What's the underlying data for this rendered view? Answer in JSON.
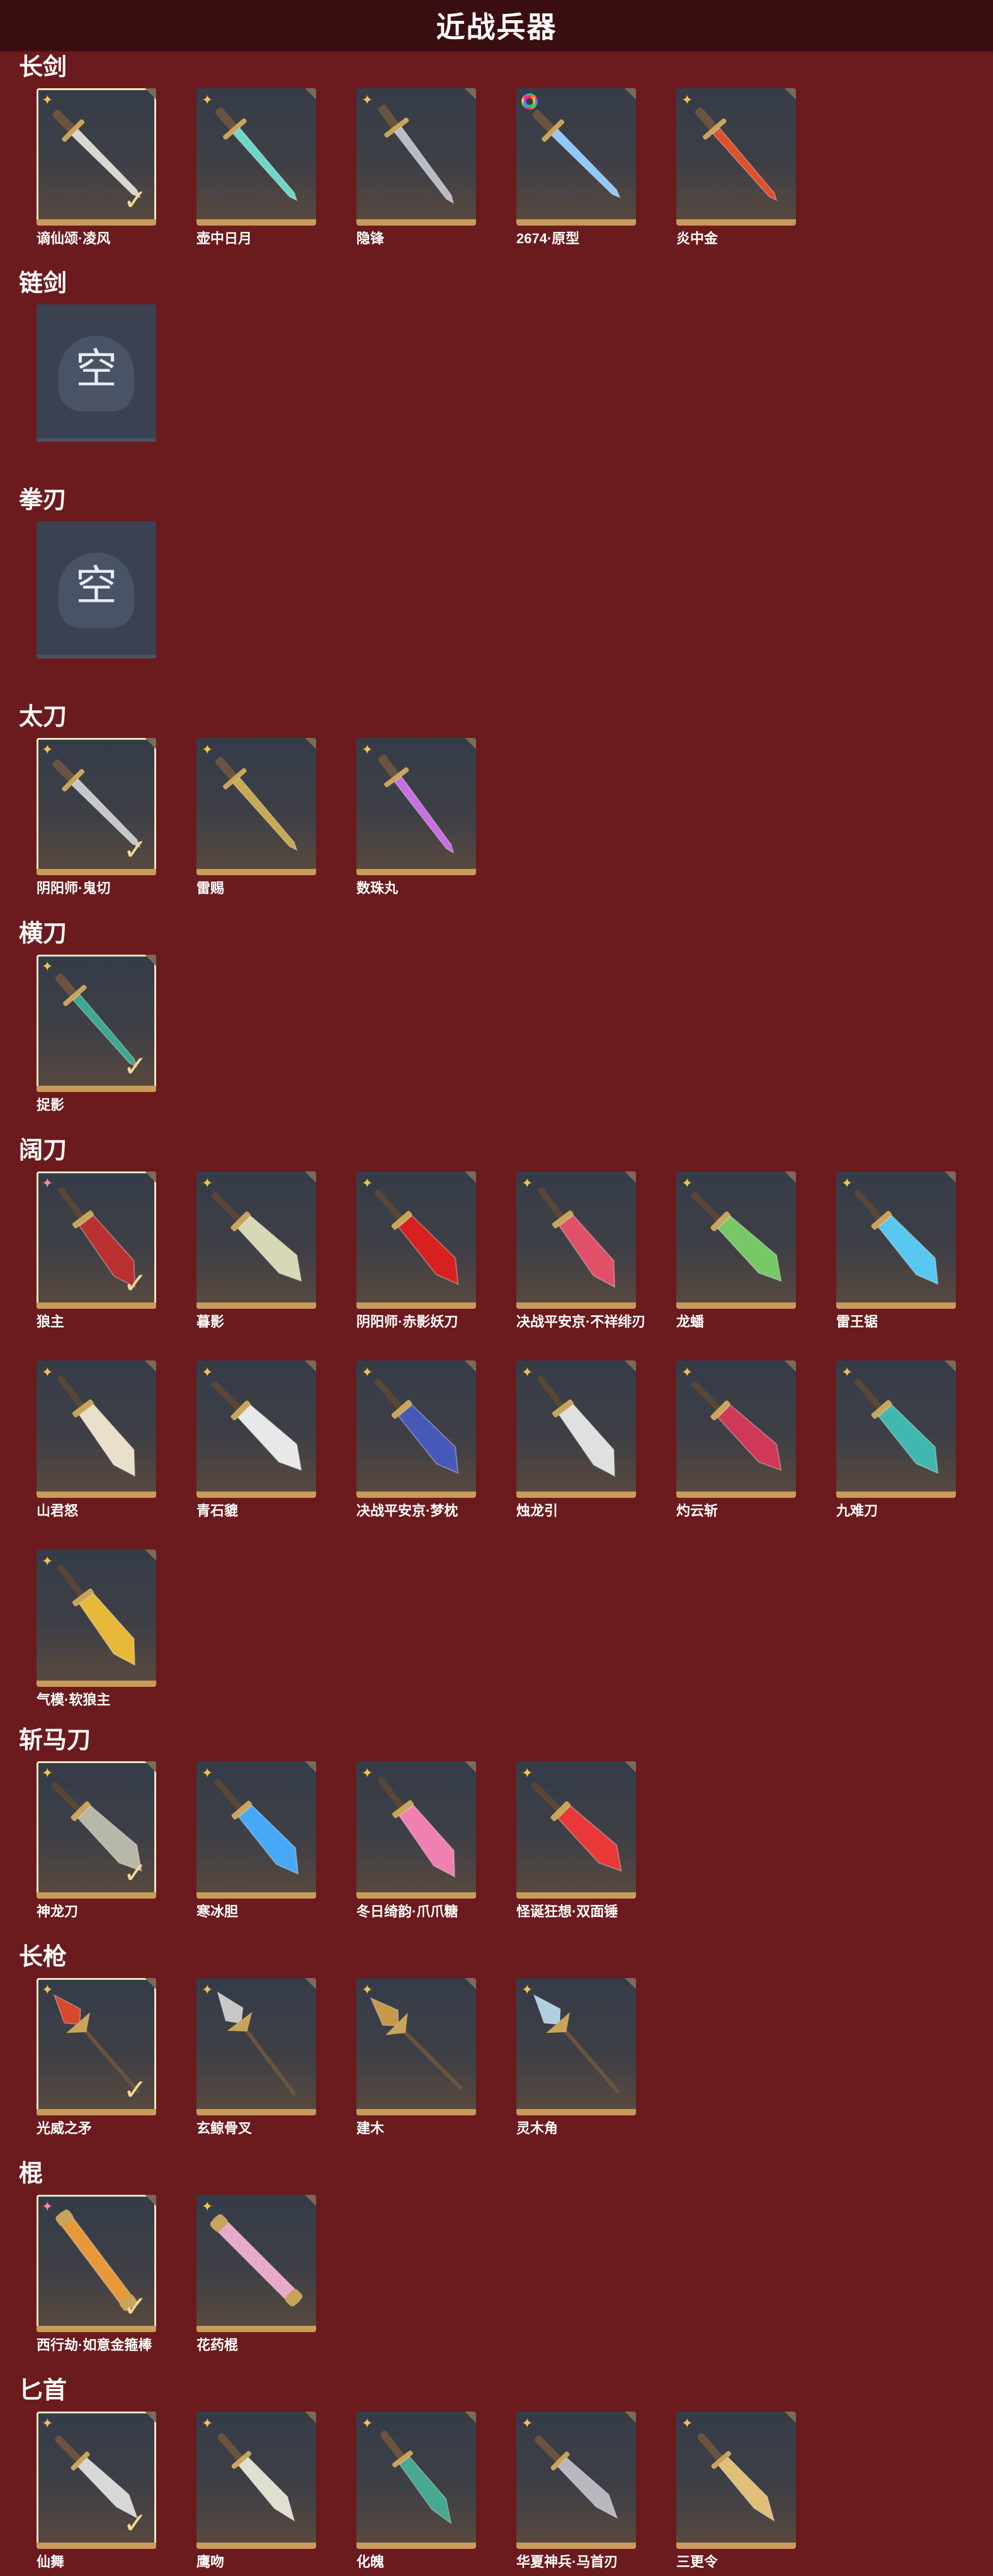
{
  "header": {
    "title": "近战兵器"
  },
  "sections": [
    {
      "id": "longsword",
      "title": "长剑",
      "items": [
        {
          "name": "谪仙颂·凌风",
          "rank": "gold",
          "selected": true,
          "color": "#d8d8d0",
          "icon": "sword-icon"
        },
        {
          "name": "壶中日月",
          "rank": "gold",
          "selected": false,
          "color": "#6ed8c8",
          "icon": "sword-icon"
        },
        {
          "name": "隐锋",
          "rank": "gold",
          "selected": false,
          "color": "#b8bcc4",
          "icon": "sword-icon"
        },
        {
          "name": "2674·原型",
          "rank": "rainbow",
          "selected": false,
          "color": "#8fc8ff",
          "icon": "sword-icon"
        },
        {
          "name": "炎中金",
          "rank": "gold",
          "selected": false,
          "color": "#e0502a",
          "icon": "sword-icon"
        }
      ]
    },
    {
      "id": "chainsword",
      "title": "链剑",
      "empty_label": "空",
      "items": []
    },
    {
      "id": "fistblade",
      "title": "拳刃",
      "empty_label": "空",
      "items": []
    },
    {
      "id": "katana",
      "title": "太刀",
      "items": [
        {
          "name": "阴阳师·鬼切",
          "rank": "gold",
          "selected": true,
          "color": "#c8c8cc",
          "icon": "katana-icon"
        },
        {
          "name": "雷赐",
          "rank": "gold",
          "selected": false,
          "color": "#c8a850",
          "icon": "katana-icon"
        },
        {
          "name": "数珠丸",
          "rank": "gold",
          "selected": false,
          "color": "#c870e0",
          "icon": "katana-icon"
        }
      ]
    },
    {
      "id": "saber",
      "title": "横刀",
      "items": [
        {
          "name": "捉影",
          "rank": "gold",
          "selected": true,
          "color": "#3ea890",
          "icon": "saber-icon"
        }
      ]
    },
    {
      "id": "broadblade",
      "title": "阔刀",
      "items": [
        {
          "name": "狼主",
          "rank": "pink",
          "selected": true,
          "color": "#b83030",
          "icon": "blade-icon"
        },
        {
          "name": "暮影",
          "rank": "gold",
          "selected": false,
          "color": "#d8d8b8",
          "icon": "blade-icon"
        },
        {
          "name": "阴阳师·赤影妖刀",
          "rank": "gold",
          "selected": false,
          "color": "#d82020",
          "icon": "blade-icon"
        },
        {
          "name": "决战平安京·不祥绯刃",
          "rank": "gold",
          "selected": false,
          "color": "#e05068",
          "icon": "blade-icon"
        },
        {
          "name": "龙蟠",
          "rank": "gold",
          "selected": false,
          "color": "#78c868",
          "icon": "blade-icon"
        },
        {
          "name": "雷王锯",
          "rank": "gold",
          "selected": false,
          "color": "#58c8f0",
          "icon": "blade-icon"
        },
        {
          "name": "山君怒",
          "rank": "gold",
          "selected": false,
          "color": "#e8e0c8",
          "icon": "blade-icon"
        },
        {
          "name": "青石貔",
          "rank": "gold",
          "selected": false,
          "color": "#e8e8e8",
          "icon": "blade-icon"
        },
        {
          "name": "决战平安京·梦枕",
          "rank": "gold",
          "selected": false,
          "color": "#4858b8",
          "icon": "blade-icon"
        },
        {
          "name": "烛龙引",
          "rank": "gold",
          "selected": false,
          "color": "#e0e0e0",
          "icon": "blade-icon"
        },
        {
          "name": "灼云斩",
          "rank": "gold",
          "selected": false,
          "color": "#d03858",
          "icon": "blade-icon"
        },
        {
          "name": "九难刀",
          "rank": "gold",
          "selected": false,
          "color": "#40b8b0",
          "icon": "blade-icon"
        },
        {
          "name": "气模·软狼主",
          "rank": "gold",
          "selected": false,
          "color": "#e8b838",
          "icon": "blade-icon"
        }
      ]
    },
    {
      "id": "zhanmadao",
      "title": "斩马刀",
      "items": [
        {
          "name": "神龙刀",
          "rank": "gold",
          "selected": true,
          "color": "#b8b8a8",
          "icon": "glaive-icon"
        },
        {
          "name": "寒冰胆",
          "rank": "gold",
          "selected": false,
          "color": "#48a8f8",
          "icon": "glaive-icon"
        },
        {
          "name": "冬日绮韵·爪爪糖",
          "rank": "gold",
          "selected": false,
          "color": "#f080b0",
          "icon": "glaive-icon"
        },
        {
          "name": "怪诞狂想·双面锤",
          "rank": "gold",
          "selected": false,
          "color": "#e83838",
          "icon": "glaive-icon"
        }
      ]
    },
    {
      "id": "spear",
      "title": "长枪",
      "items": [
        {
          "name": "光威之矛",
          "rank": "gold",
          "selected": true,
          "color": "#d84830",
          "icon": "spear-icon"
        },
        {
          "name": "玄鲸骨叉",
          "rank": "gold",
          "selected": false,
          "color": "#c8c8c8",
          "icon": "spear-icon"
        },
        {
          "name": "建木",
          "rank": "gold",
          "selected": false,
          "color": "#c89848",
          "icon": "spear-icon"
        },
        {
          "name": "灵木角",
          "rank": "gold",
          "selected": false,
          "color": "#b0d0e0",
          "icon": "spear-icon"
        }
      ]
    },
    {
      "id": "staff",
      "title": "棍",
      "items": [
        {
          "name": "西行劫·如意金箍棒",
          "rank": "pink",
          "selected": true,
          "color": "#e89838",
          "icon": "staff-icon"
        },
        {
          "name": "花药棍",
          "rank": "gold",
          "selected": false,
          "color": "#e8a8c8",
          "icon": "staff-icon"
        }
      ]
    },
    {
      "id": "dagger",
      "title": "匕首",
      "items": [
        {
          "name": "仙舞",
          "rank": "gold",
          "selected": true,
          "color": "#d8d8d8",
          "icon": "dagger-icon"
        },
        {
          "name": "鹰吻",
          "rank": "gold",
          "selected": false,
          "color": "#e0e0d0",
          "icon": "dagger-icon"
        },
        {
          "name": "化魄",
          "rank": "gold",
          "selected": false,
          "color": "#48a890",
          "icon": "dagger-icon"
        },
        {
          "name": "华夏神兵·马首刃",
          "rank": "gold",
          "selected": false,
          "color": "#b8b8c0",
          "icon": "dagger-icon"
        },
        {
          "name": "三更令",
          "rank": "gold",
          "selected": false,
          "color": "#e0c078",
          "icon": "dagger-icon"
        }
      ]
    }
  ]
}
